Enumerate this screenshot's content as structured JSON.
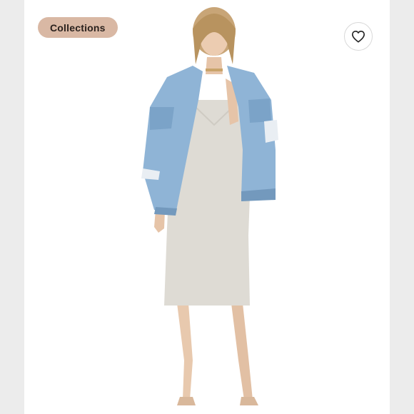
{
  "listing": {
    "collection_label": "Collections",
    "like_icon": "heart-icon"
  },
  "colors": {
    "pill_bg": "#d9b8a4",
    "pill_text": "#2a211d",
    "denim": "#8fb4d6",
    "dress": "#dedbd4"
  }
}
